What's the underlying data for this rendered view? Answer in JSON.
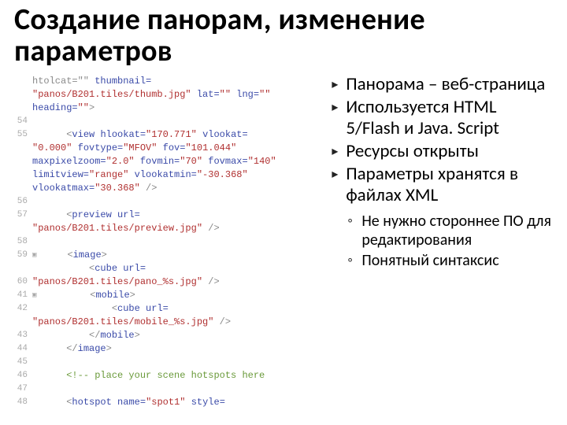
{
  "title": "Создание панорам, изменение параметров",
  "bullets": {
    "main": [
      "Панорама – веб-страница",
      "Используется HTML 5/Flash и Java. Script",
      "Ресурсы открыты",
      "Параметры хранятся в файлах XML"
    ],
    "sub": [
      "Не нужно стороннее ПО для редактирования",
      "Понятный синтаксис"
    ]
  },
  "code": {
    "gutter": [
      "",
      "",
      "",
      "54",
      "55",
      "",
      "",
      "",
      "",
      "56",
      "57",
      "",
      "58",
      "59",
      "",
      "60",
      "41",
      "42",
      "",
      "43",
      "44",
      "45",
      "46",
      "47",
      "48"
    ],
    "lines": [
      {
        "html": "<span class='g'>htolcat=\"\"</span> <span class='k'>thumbnail=</span>"
      },
      {
        "html": "<span class='v'>\"panos/B201.tiles/thumb.jpg\"</span> <span class='k'>lat=</span><span class='v'>\"\"</span> <span class='k'>lng=</span><span class='v'>\"\"</span>"
      },
      {
        "html": "<span class='k'>heading=</span><span class='v'>\"\"</span><span class='g'>&gt;</span>"
      },
      {
        "html": ""
      },
      {
        "html": "      <span class='g'>&lt;</span><span class='k'>view</span> <span class='k'>hlookat=</span><span class='v'>\"170.771\"</span> <span class='k'>vlookat=</span>"
      },
      {
        "html": "<span class='v'>\"0.000\"</span> <span class='k'>fovtype=</span><span class='v'>\"MFOV\"</span> <span class='k'>fov=</span><span class='v'>\"101.044\"</span>"
      },
      {
        "html": "<span class='k'>maxpixelzoom=</span><span class='v'>\"2.0\"</span> <span class='k'>fovmin=</span><span class='v'>\"70\"</span> <span class='k'>fovmax=</span><span class='v'>\"140\"</span>"
      },
      {
        "html": "<span class='k'>limitview=</span><span class='v'>\"range\"</span> <span class='k'>vlookatmin=</span><span class='v'>\"-30.368\"</span>"
      },
      {
        "html": "<span class='k'>vlookatmax=</span><span class='v'>\"30.368\"</span> <span class='g'>/&gt;</span>"
      },
      {
        "html": ""
      },
      {
        "html": "      <span class='g'>&lt;</span><span class='k'>preview</span> <span class='k'>url=</span>"
      },
      {
        "html": "<span class='v'>\"panos/B201.tiles/preview.jpg\"</span> <span class='g'>/&gt;</span>"
      },
      {
        "html": ""
      },
      {
        "html": "<span class='fold'>▣</span>     <span class='g'>&lt;</span><span class='k'>image</span><span class='g'>&gt;</span>"
      },
      {
        "html": "          <span class='g'>&lt;</span><span class='k'>cube</span> <span class='k'>url=</span>"
      },
      {
        "html": "<span class='v'>\"panos/B201.tiles/pano_%s.jpg\"</span> <span class='g'>/&gt;</span>"
      },
      {
        "html": "<span class='fold'>▣</span>         <span class='g'>&lt;</span><span class='k'>mobile</span><span class='g'>&gt;</span>"
      },
      {
        "html": "              <span class='g'>&lt;</span><span class='k'>cube</span> <span class='k'>url=</span>"
      },
      {
        "html": "<span class='v'>\"panos/B201.tiles/mobile_%s.jpg\"</span> <span class='g'>/&gt;</span>"
      },
      {
        "html": "          <span class='g'>&lt;/</span><span class='k'>mobile</span><span class='g'>&gt;</span>"
      },
      {
        "html": "      <span class='g'>&lt;/</span><span class='k'>image</span><span class='g'>&gt;</span>"
      },
      {
        "html": ""
      },
      {
        "html": "      <span class='c'>&lt;!-- place your scene hotspots here</span>"
      },
      {
        "html": ""
      },
      {
        "html": "      <span class='g'>&lt;</span><span class='k'>hotspot</span> <span class='k'>name=</span><span class='v'>\"spot1\"</span> <span class='k'>style=</span>                 "
      }
    ]
  }
}
